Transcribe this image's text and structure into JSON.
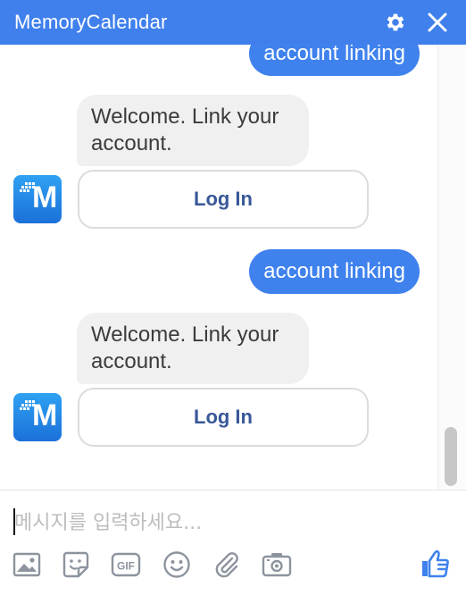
{
  "app": {
    "title": "MemoryCalendar"
  },
  "header": {
    "icons": [
      "gear-icon",
      "close-icon"
    ]
  },
  "messages": [
    {
      "type": "outgoing",
      "text": "account linking"
    },
    {
      "type": "incoming",
      "text": "Welcome. Link your account.",
      "button": "Log In"
    },
    {
      "type": "outgoing",
      "text": "account linking"
    },
    {
      "type": "incoming",
      "text": "Welcome. Link your account.",
      "button": "Log In"
    }
  ],
  "composer": {
    "placeholder": "메시지를 입력하세요...",
    "tools": [
      "image-icon",
      "sticker-icon",
      "gif-icon",
      "emoji-icon",
      "attachment-icon",
      "camera-icon"
    ],
    "like_icon": "thumbs-up-icon",
    "gif_label": "GIF"
  },
  "colors": {
    "header": "#4080ec",
    "outgoing_bubble": "#3f82ee",
    "incoming_bubble": "#f1f0f0",
    "button_text": "#385898",
    "icon_gray": "#8d949e",
    "like": "#3f82ee"
  }
}
